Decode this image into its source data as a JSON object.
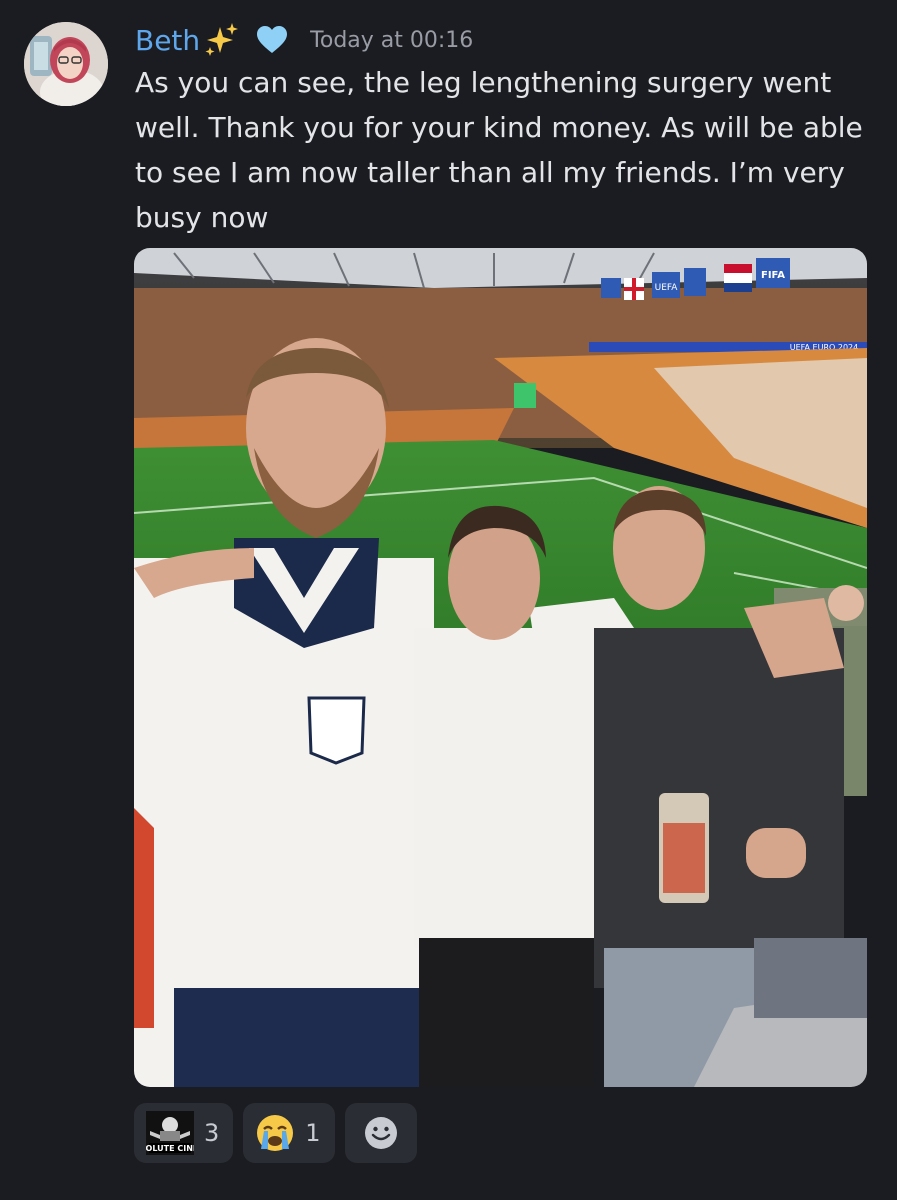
{
  "author": {
    "name": "Beth",
    "badge_icon": "sparkles-icon",
    "role_icon": "blue-heart-icon",
    "name_color": "#5fa7ec"
  },
  "timestamp": "Today at 00:16",
  "message": {
    "text": "As you can see, the leg lengthening surgery went well. Thank you for your kind money. As will be able to see I am now taller than all my friends. I’m very busy now"
  },
  "attachment": {
    "type": "photo",
    "signage": [
      "UEFA",
      "FIFA",
      "UEFA EURO 2024"
    ]
  },
  "reactions": [
    {
      "icon": "absolute-cinema-sticker",
      "label": "ABSOLUTE CINEMA",
      "count": "3"
    },
    {
      "icon": "loudly-crying-face-icon",
      "count": "1"
    }
  ],
  "add_reaction": {
    "icon": "add-reaction-smiley-icon"
  }
}
